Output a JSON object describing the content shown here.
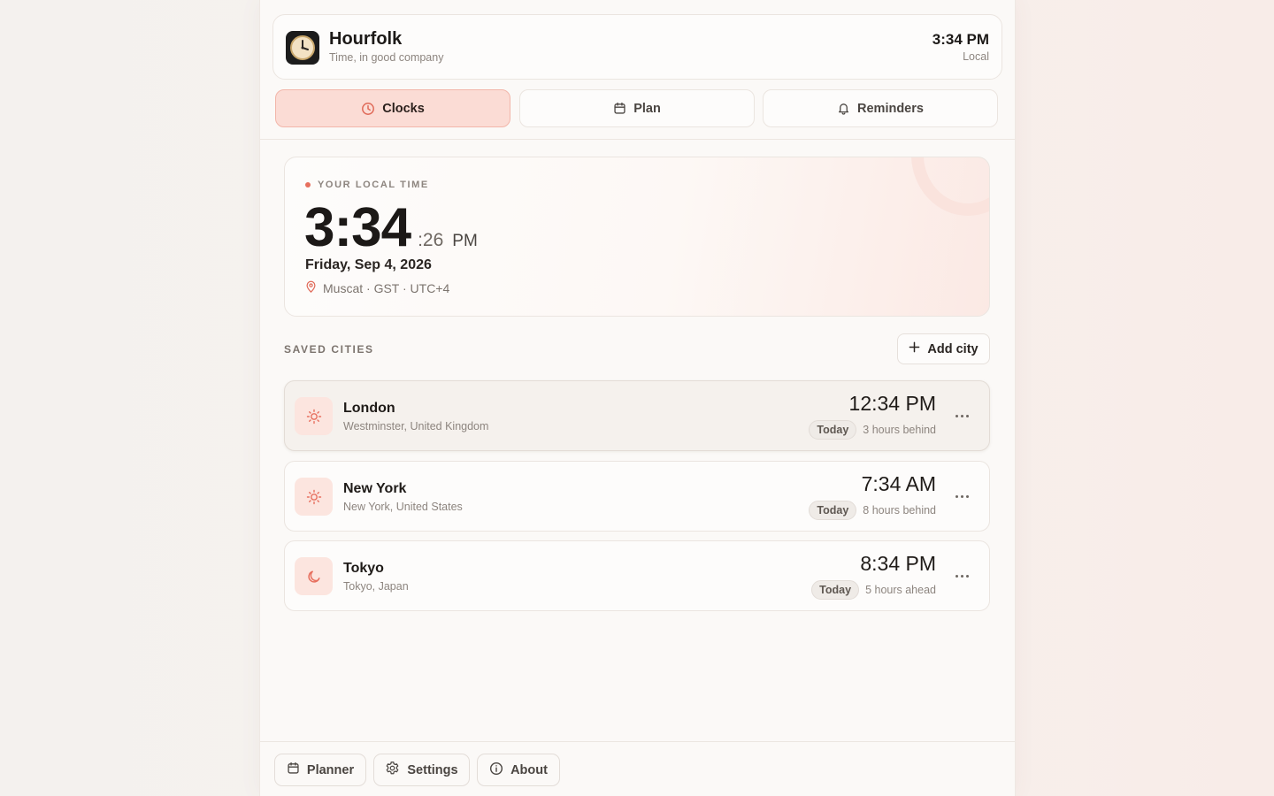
{
  "header": {
    "app_name": "Hourfolk",
    "tagline": "Time, in good company",
    "current_time": "3:34 PM",
    "time_label": "Local"
  },
  "tabs": [
    {
      "label": "Clocks",
      "icon": "clock-icon",
      "active": true
    },
    {
      "label": "Plan",
      "icon": "calendar-icon",
      "active": false
    },
    {
      "label": "Reminders",
      "icon": "bell-icon",
      "active": false
    }
  ],
  "local": {
    "label": "YOUR LOCAL TIME",
    "hours_minutes": "3:34",
    "seconds": ":26",
    "ampm": "PM",
    "date": "Friday, Sep 4, 2026",
    "location": "Muscat · GST · UTC+4"
  },
  "saved": {
    "label": "SAVED CITIES",
    "add_label": "Add city"
  },
  "cities": [
    {
      "name": "London",
      "region": "Westminster, United Kingdom",
      "time": "12:34 PM",
      "day": "Today",
      "offset": "3 hours behind",
      "icon": "sun-icon"
    },
    {
      "name": "New York",
      "region": "New York, United States",
      "time": "7:34 AM",
      "day": "Today",
      "offset": "8 hours behind",
      "icon": "sun-icon"
    },
    {
      "name": "Tokyo",
      "region": "Tokyo, Japan",
      "time": "8:34 PM",
      "day": "Today",
      "offset": "5 hours ahead",
      "icon": "moon-icon"
    }
  ],
  "footer": {
    "planner": "Planner",
    "settings": "Settings",
    "about": "About"
  },
  "colors": {
    "accent": "#e76f5e",
    "active_tab_bg": "#fbdcd5",
    "icon_tile_bg": "#fce5df"
  }
}
